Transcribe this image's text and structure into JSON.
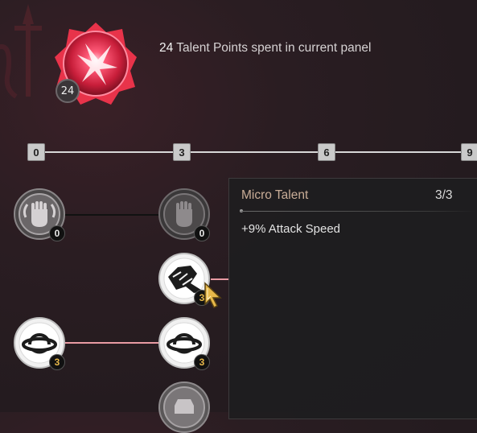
{
  "header": {
    "points_spent": "24",
    "text": "Talent Points spent in current panel",
    "badge_count": "24"
  },
  "progress": {
    "markers": [
      "0",
      "3",
      "6",
      "9"
    ]
  },
  "nodes": [
    {
      "id": "fist-1",
      "icon": "fist-icon",
      "count": "0",
      "state": "locked"
    },
    {
      "id": "fist-2",
      "icon": "fist-icon",
      "count": "0",
      "state": "locked"
    },
    {
      "id": "claw",
      "icon": "claw-icon",
      "count": "3",
      "state": "maxed"
    },
    {
      "id": "orb-1",
      "icon": "orb-ring-icon",
      "count": "3",
      "state": "maxed"
    },
    {
      "id": "orb-2",
      "icon": "orb-ring-icon",
      "count": "3",
      "state": "maxed"
    },
    {
      "id": "armor",
      "icon": "armor-icon",
      "count": "",
      "state": "locked"
    }
  ],
  "tooltip": {
    "title": "Micro Talent",
    "rank": "3/3",
    "description": "+9% Attack Speed"
  },
  "colors": {
    "accent_gold": "#e7b84a",
    "tooltip_title": "#c9ad97",
    "main_badge": "#e8334a"
  }
}
